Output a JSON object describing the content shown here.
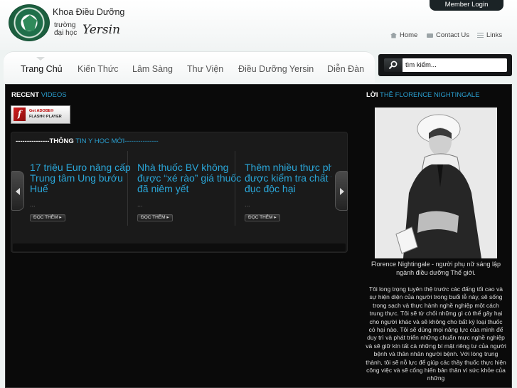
{
  "brand": {
    "title": "Khoa Điều Dưỡng",
    "sub_line1": "trường",
    "sub_line2": "đại học",
    "name": "Yersin"
  },
  "header": {
    "member_login": "Member Login",
    "links": [
      {
        "label": "Home",
        "icon": "home-icon"
      },
      {
        "label": "Contact Us",
        "icon": "mail-icon"
      },
      {
        "label": "Links",
        "icon": "list-icon"
      }
    ]
  },
  "nav": {
    "items": [
      {
        "label": "Trang Chủ",
        "active": true
      },
      {
        "label": "Kiến Thức"
      },
      {
        "label": "Lâm Sàng"
      },
      {
        "label": "Thư Viện"
      },
      {
        "label": "Điều Dưỡng Yersin"
      },
      {
        "label": "Diễn Đàn"
      }
    ]
  },
  "search": {
    "placeholder": "tìm kiếm...",
    "icon": "search-icon"
  },
  "videos": {
    "title_bold": "RECENT",
    "title_accent": " VIDEOS",
    "flash_line1": "Get ADOBE®",
    "flash_line2": "FLASH® PLAYER",
    "flash_logo": "f"
  },
  "news": {
    "head_bold": "---------------THÔNG",
    "head_accent": " TIN Y HỌC MỚI---------------",
    "read_more": "ĐỌC THÊM ▸",
    "items": [
      {
        "title": "17 triệu Euro nâng cấp Trung tâm Ung bướu Huế",
        "ellipsis": "..."
      },
      {
        "title": "Nhà thuốc BV không được “xé rào” giá thuốc đã niêm yết",
        "ellipsis": "..."
      },
      {
        "title": "Thêm nhiều thực phẩm được kiểm tra chất tạo đục độc hại",
        "ellipsis": "..."
      }
    ]
  },
  "sidebar": {
    "title_bold": "LỜI",
    "title_accent": " THỀ FLORENCE NIGHTINGALE",
    "caption": "Florence Nightingale - người phụ nữ sáng lập ngành điều dưỡng Thế giới.",
    "oath": "Tôi long trọng tuyên thệ trước các đấng tối cao và sự hiện diện của người trong buổi lễ này, sẽ sống trong sạch và thực hành nghề nghiệp một cách trung thực. Tôi sẽ từ chối những gì có thể gây hại cho người khác và sẽ không cho bất kỳ loại thuốc có hại nào. Tôi sẽ dùng mọi năng lực của mình để duy trì và phát triển những chuẩn mực nghề nghiệp và sẽ giữ kín tất cả những bí mật riêng tư của người bệnh và thân nhân người bệnh. Với lòng trung thành, tôi sẽ nỗ lực để giúp các thầy thuốc thực hiện công việc và sẽ cống hiến bản thân vì sức khỏe của những"
  }
}
